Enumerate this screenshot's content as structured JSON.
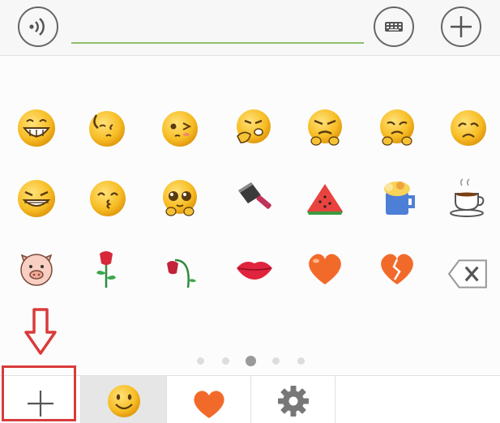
{
  "input": {
    "value": "",
    "placeholder": ""
  },
  "top_bar": {
    "voice_button_icon": "voice-icon",
    "keyboard_button_icon": "keyboard-icon",
    "add_button_icon": "plus-icon"
  },
  "emoji_grid": {
    "rows": [
      [
        "grin",
        "shy",
        "embarrassed",
        "cover-mouth-laugh",
        "frown-angry",
        "sad-fists",
        "sorrowful"
      ],
      [
        "sneaky-grin",
        "kiss",
        "teary-eyes",
        "cleaver",
        "watermelon",
        "beer",
        "coffee-cup"
      ],
      [
        "pig",
        "rose",
        "wilted-rose",
        "lips",
        "heart",
        "broken-heart",
        "backspace"
      ]
    ]
  },
  "pager": {
    "count": 5,
    "active_index": 2
  },
  "bottom_tabs": [
    {
      "name": "add-emoji-tab",
      "icon": "plus-icon"
    },
    {
      "name": "smiley-tab",
      "icon": "smiley-icon",
      "selected": true
    },
    {
      "name": "favorites-tab",
      "icon": "heart-icon"
    },
    {
      "name": "settings-tab",
      "icon": "gear-icon"
    }
  ],
  "colors": {
    "accent_line": "#8dbf6a",
    "highlight": "#d93b3b",
    "emoji_yellow": "#f5b921",
    "heart_orange": "#f26a2a"
  }
}
